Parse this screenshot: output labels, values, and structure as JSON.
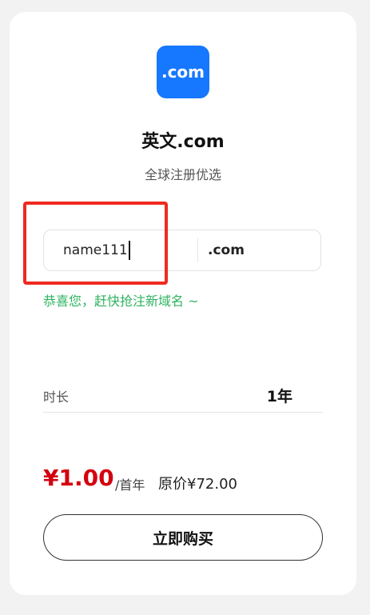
{
  "product": {
    "icon_text": ".com",
    "icon_name": "dot-com-icon",
    "accent_color": "#1677ff",
    "title": "英文.com",
    "subtitle": "全球注册优选"
  },
  "search": {
    "value": "name111",
    "suffix": ".com",
    "hint": "恭喜您，赶快抢注新域名 ~",
    "hint_color": "#2fb360",
    "highlight_color": "#ee2a1f"
  },
  "duration": {
    "label": "时长",
    "value": "1年"
  },
  "pricing": {
    "price": "¥1.00",
    "period": "/首年",
    "original": "原价¥72.00",
    "price_color": "#d4000f"
  },
  "actions": {
    "buy_label": "立即购买"
  }
}
